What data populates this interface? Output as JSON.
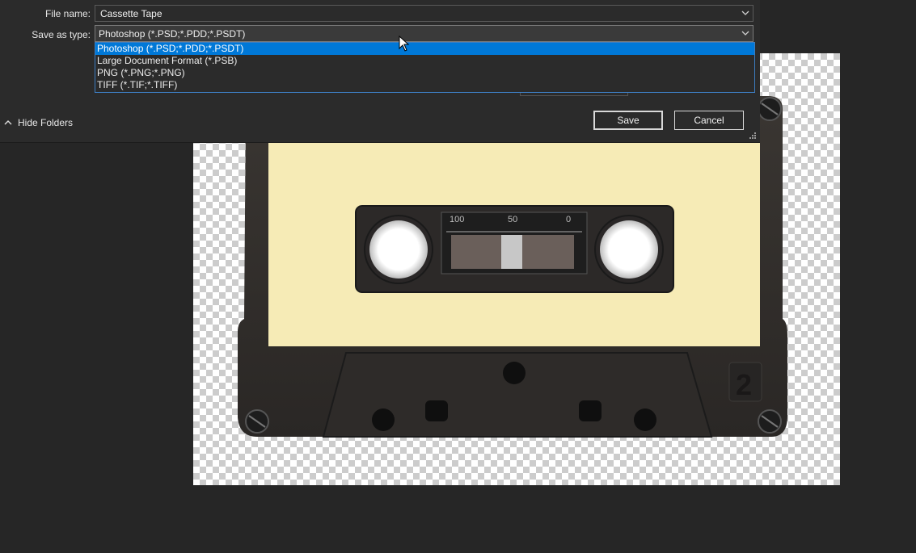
{
  "dialog": {
    "file_name_label": "File name:",
    "file_name_value": "Cassette Tape",
    "save_type_label": "Save as type:",
    "save_type_value": "Photoshop (*.PSD;*.PDD;*.PSDT)",
    "type_options": [
      "Photoshop (*.PSD;*.PDD;*.PSDT)",
      "Large Document Format (*.PSB)",
      "PNG (*.PNG;*.PNG)",
      "TIFF (*.TIF;*.TIFF)"
    ],
    "hide_folders_label": "Hide Folders",
    "save_label": "Save",
    "cancel_label": "Cancel"
  },
  "cassette": {
    "scale_labels": [
      "100",
      "50",
      "0"
    ],
    "side_label": "2"
  },
  "colors": {
    "accent": "#0078d7",
    "dialog_bg": "#2b2b2b",
    "workspace_bg": "#262626",
    "label_paper": "#f6ebb6"
  }
}
